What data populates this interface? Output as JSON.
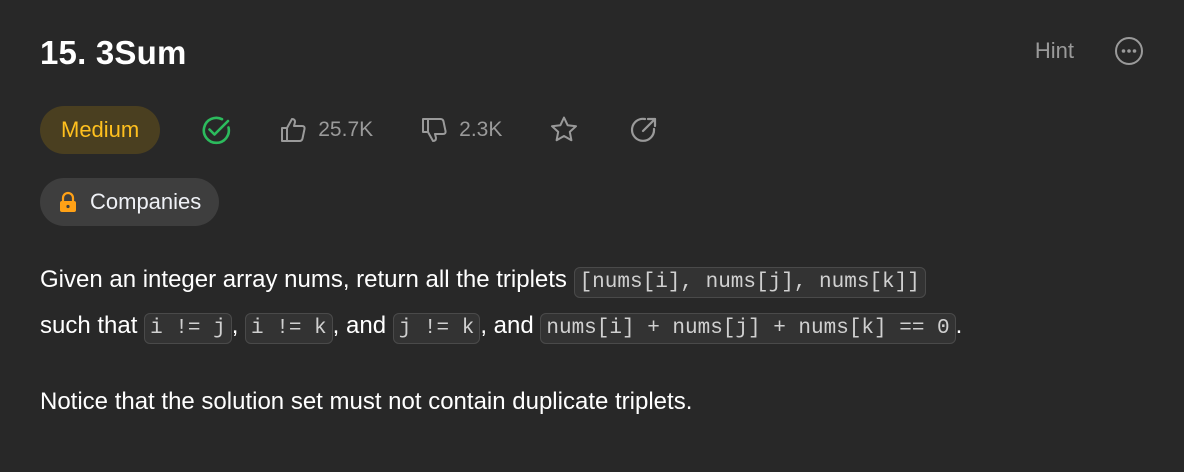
{
  "problem": {
    "title": "15. 3Sum",
    "hint_label": "Hint",
    "difficulty": "Medium",
    "likes": "25.7K",
    "dislikes": "2.3K",
    "companies_label": "Companies"
  },
  "description": {
    "p1_text1": "Given an integer array nums, return all the triplets ",
    "p1_code1": "[nums[i], nums[j], nums[k]]",
    "p1_text2": " such that ",
    "p1_code2": "i != j",
    "p1_text3": ", ",
    "p1_code3": "i != k",
    "p1_text4": ", and ",
    "p1_code4": "j != k",
    "p1_text5": ", and ",
    "p1_code5": "nums[i] + nums[j] + nums[k] == 0",
    "p1_text6": ".",
    "p2": "Notice that the solution set must not contain duplicate triplets."
  },
  "colors": {
    "background": "#282828",
    "medium": "#ffc01e",
    "solved": "#2cbb5d",
    "muted": "#9a9a9a"
  },
  "icons": [
    "more-icon",
    "solved-check-icon",
    "thumbs-up-icon",
    "thumbs-down-icon",
    "star-icon",
    "share-icon",
    "lock-icon"
  ]
}
